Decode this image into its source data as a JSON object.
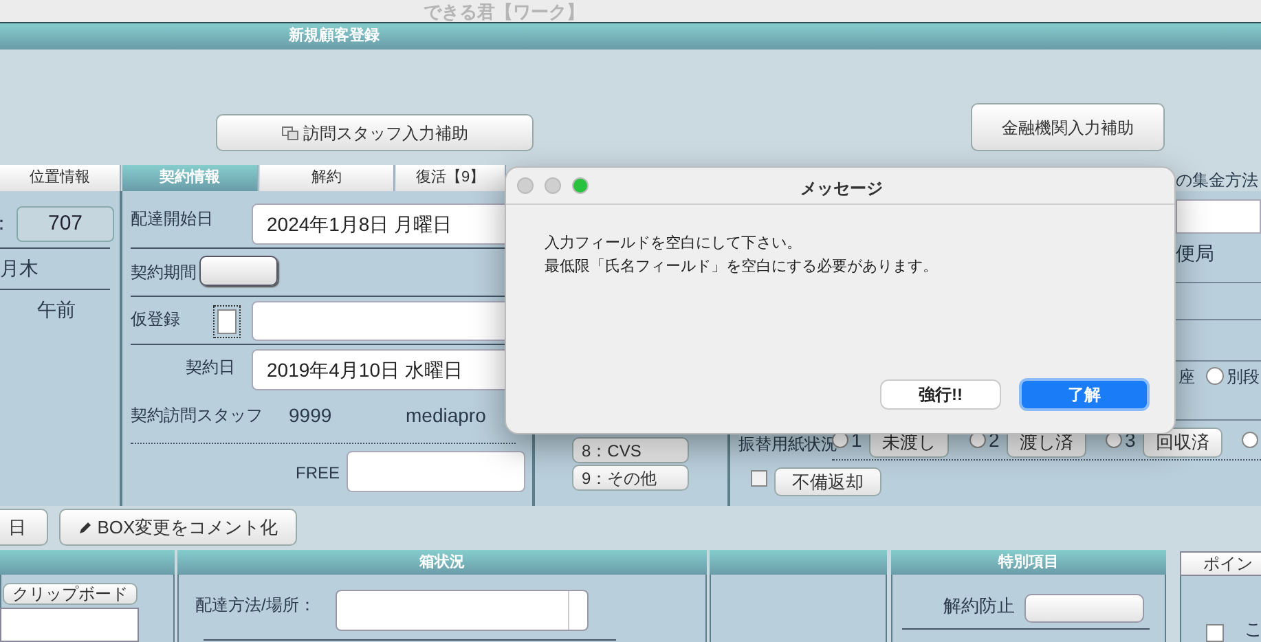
{
  "app_title": "できる君【ワーク】",
  "header": "新規顧客登録",
  "assist_buttons": [
    {
      "label": "訪問スタッフ入力補助",
      "kind": "copy"
    },
    {
      "label": "金融機関入力補助",
      "kind": "plain"
    }
  ],
  "tabs": [
    {
      "label": "位置情報",
      "selected": false
    },
    {
      "label": "契約情報",
      "selected": true
    },
    {
      "label": "解約",
      "selected": false
    },
    {
      "label": "復活【9】",
      "selected": false
    }
  ],
  "left_panel": {
    "code_separator": "：",
    "code": "707",
    "days": "月木",
    "time": "午前"
  },
  "contract": {
    "start_label": "配達開始日",
    "start_value": "2024年1月8日 月曜日",
    "period_label": "契約期間",
    "provisional_label": "仮登録",
    "provisional_checked": false,
    "date_label": "契約日",
    "date_value": "2019年4月10日 水曜日",
    "staff_label": "契約訪問スタッフ",
    "staff_code": "9999",
    "staff_name": "mediapro",
    "free_label": "FREE"
  },
  "payment_buttons": [
    "8：CVS",
    "9：その他"
  ],
  "right_panel": {
    "heading": "の集金方法",
    "post": "便局",
    "account": "座",
    "separate": "別段",
    "separate_selected": false,
    "slip_label": "振替用紙状況",
    "slip_options": [
      {
        "number": "1",
        "label": "未渡し",
        "selected": false
      },
      {
        "number": "2",
        "label": "渡し済",
        "selected": false
      },
      {
        "number": "3",
        "label": "回収済",
        "selected": false
      },
      {
        "selected": false
      }
    ],
    "return_checked": false,
    "return_label": "不備返却"
  },
  "toolbar": [
    {
      "label": "日",
      "kind": "plain"
    },
    {
      "label": "BOX変更をコメント化",
      "kind": "pencil"
    }
  ],
  "clipboard_button": "クリップボード",
  "box_status": {
    "title": "箱状況",
    "delivery_label": "配達方法/場所："
  },
  "special": {
    "title": "特別項目",
    "cancel_label": "解約防止"
  },
  "points": {
    "title": "ポイン",
    "checked": false,
    "label": "こ"
  },
  "dialog": {
    "title": "メッセージ",
    "lines": [
      "入力フィールドを空白にして下さい。",
      "最低限「氏名フィールド」を空白にする必要があります。"
    ],
    "buttons": [
      {
        "label": "強行!!",
        "default": false
      },
      {
        "label": "了解",
        "default": true
      }
    ]
  }
}
